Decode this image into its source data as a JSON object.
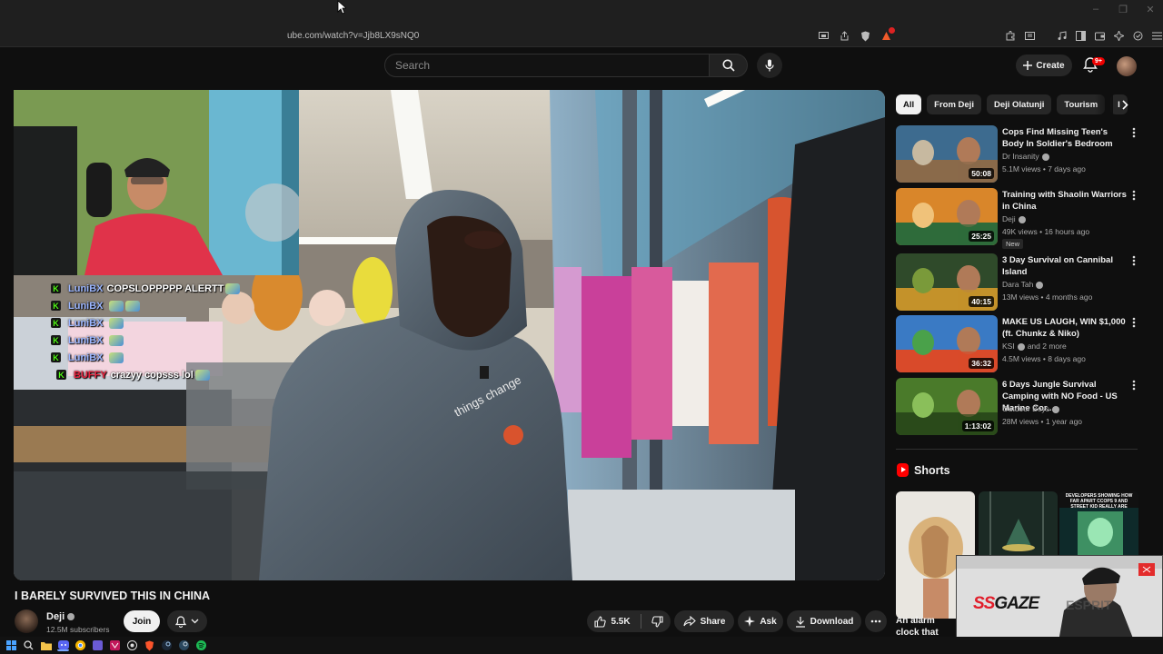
{
  "browser": {
    "url": "ube.com/watch?v=Jjb8LX9sNQ0",
    "window_controls": [
      "–",
      "❐",
      "✕"
    ],
    "address_icons": [
      "screen-cast-icon",
      "share-icon",
      "brave-shield-icon",
      "brave-rewards-icon"
    ],
    "toolbar_icons": [
      "extensions-icon",
      "reader-icon",
      "music-icon",
      "sidebar-icon",
      "wallet-icon",
      "ai-icon",
      "vpn-icon",
      "menu-icon"
    ]
  },
  "header": {
    "search_placeholder": "Search",
    "create_label": "Create",
    "notification_count": "9+"
  },
  "player": {
    "webcam_overlay": true,
    "chat": [
      {
        "badge": "K",
        "user": "LuniBX",
        "message": "COPSLOPPPPP ALERTT",
        "emotes": 1,
        "user_color": "#9bb6ff"
      },
      {
        "badge": "K",
        "user": "LuniBX",
        "message": "",
        "emotes": 2,
        "user_color": "#9bb6ff"
      },
      {
        "badge": "K",
        "user": "LuniBX",
        "message": "",
        "emotes": 1,
        "user_color": "#9bb6ff"
      },
      {
        "badge": "K",
        "user": "LuniBX",
        "message": "",
        "emotes": 1,
        "user_color": "#9bb6ff"
      },
      {
        "badge": "K",
        "user": "LuniBX",
        "message": "",
        "emotes": 1,
        "user_color": "#9bb6ff"
      },
      {
        "badge": "K",
        "user": "BUFFY",
        "message": "crazyy copsss lol",
        "emotes": 1,
        "user_color": "#e8213d"
      }
    ],
    "shirt_text": "things change"
  },
  "video": {
    "title": "I BARELY SURVIVED THIS IN CHINA",
    "channel": "Deji",
    "subscribers": "12.5M subscribers",
    "join_label": "Join",
    "likes": "5.5K",
    "share_label": "Share",
    "ask_label": "Ask",
    "download_label": "Download"
  },
  "sidebar": {
    "chips": [
      {
        "label": "All",
        "active": true
      },
      {
        "label": "From Deji",
        "active": false
      },
      {
        "label": "Deji Olatunji",
        "active": false
      },
      {
        "label": "Tourism",
        "active": false
      },
      {
        "label": "I",
        "active": false
      }
    ],
    "recommendations": [
      {
        "title": "Cops Find Missing Teen's Body In Soldier's Bedroom",
        "channel": "Dr Insanity",
        "verified": true,
        "meta": "5.1M views • 7 days ago",
        "duration": "50:08",
        "is_new": false
      },
      {
        "title": "Training with Shaolin Warriors in China",
        "channel": "Deji",
        "verified": true,
        "meta": "49K views • 16 hours ago",
        "duration": "25:25",
        "is_new": true,
        "new_label": "New"
      },
      {
        "title": "3 Day Survival on Cannibal Island",
        "channel": "Dara Tah",
        "verified": true,
        "meta": "13M views • 4 months ago",
        "duration": "40:15",
        "is_new": false
      },
      {
        "title": "MAKE US LAUGH, WIN $1,000 (ft. Chunkz & Niko)",
        "channel": "KSI",
        "verified": true,
        "channel_suffix": "and 2 more",
        "meta": "4.5M views • 8 days ago",
        "duration": "36:32",
        "is_new": false
      },
      {
        "title": "6 Days Jungle Survival Camping with NO Food - US Marine Cor...",
        "channel": "Outdoor Boys",
        "verified": true,
        "meta": "28M views • 1 year ago",
        "duration": "1:13:02",
        "is_new": false
      }
    ],
    "shorts_heading": "Shorts",
    "short_caption": "An alarm clock that",
    "short_thumb_text": "DEVELOPERS SHOWING HOW FAR APART CCOPS 9 AND STREET KID REALLY ARE"
  },
  "streamer_overlay": {
    "logo_prefix": "SS",
    "logo_suffix": "GAZE",
    "corner_badge": "",
    "bg_text": "ESPRIT"
  },
  "taskbar": {
    "icons": [
      "windows-start-icon",
      "search-icon",
      "file-explorer-icon",
      "discord-icon",
      "chrome-icon",
      "app-icon",
      "app-icon-2",
      "github-icon",
      "brave-icon",
      "steam-icon",
      "steam-icon-2",
      "spotify-icon"
    ]
  },
  "colors": {
    "background": "#0f0f0f",
    "accent_red": "#ff0000",
    "kick_green": "#53fc18",
    "chip_bg": "#272727"
  }
}
